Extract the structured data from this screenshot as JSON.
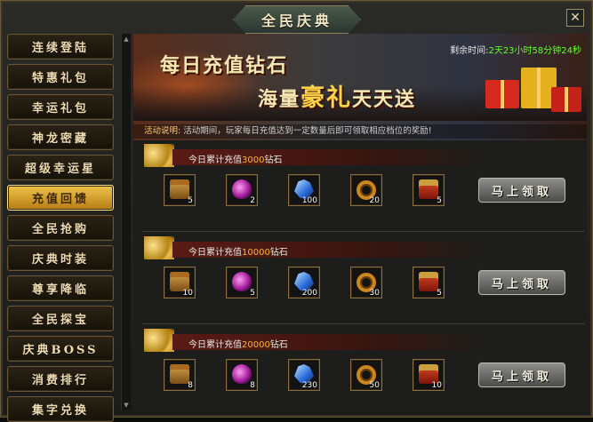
{
  "window": {
    "title": "全民庆典",
    "close_glyph": "✕"
  },
  "sidebar": {
    "items": [
      {
        "label": "连续登陆",
        "active": false
      },
      {
        "label": "特惠礼包",
        "active": false
      },
      {
        "label": "幸运礼包",
        "active": false
      },
      {
        "label": "神龙密藏",
        "active": false
      },
      {
        "label": "超级幸运星",
        "active": false
      },
      {
        "label": "充值回馈",
        "active": true
      },
      {
        "label": "全民抢购",
        "active": false
      },
      {
        "label": "庆典时装",
        "active": false
      },
      {
        "label": "尊享降临",
        "active": false
      },
      {
        "label": "全民探宝",
        "active": false
      },
      {
        "label": "庆典BOSS",
        "active": false
      },
      {
        "label": "消费排行",
        "active": false
      },
      {
        "label": "集字兑换",
        "active": false
      }
    ]
  },
  "banner": {
    "line1": "每日充值钻石",
    "line2_pre": "海量",
    "line2_hl": "豪礼",
    "line2_post": "天天送",
    "timer_label": "剩余时间:",
    "timer_value": "2天23小时58分钟24秒",
    "notice_label": "活动说明:",
    "notice_text": "活动期间，玩家每日充值达到一定数量后即可领取相应档位的奖励!"
  },
  "tiers": [
    {
      "req_prefix": "今日累计充值",
      "amount": "3000",
      "req_suffix": "钻石",
      "items": [
        {
          "icon": "gold-chest-icon",
          "qty": "5"
        },
        {
          "icon": "purple-gem-icon",
          "qty": "2"
        },
        {
          "icon": "blue-crystal-icon",
          "qty": "100"
        },
        {
          "icon": "gold-ring-icon",
          "qty": "20"
        },
        {
          "icon": "red-chest-icon",
          "qty": "5"
        }
      ],
      "claim_label": "马上领取"
    },
    {
      "req_prefix": "今日累计充值",
      "amount": "10000",
      "req_suffix": "钻石",
      "items": [
        {
          "icon": "gold-chest-icon",
          "qty": "10"
        },
        {
          "icon": "purple-gem-icon",
          "qty": "5"
        },
        {
          "icon": "blue-crystal-icon",
          "qty": "200"
        },
        {
          "icon": "gold-ring-icon",
          "qty": "30"
        },
        {
          "icon": "red-chest-icon",
          "qty": "5"
        }
      ],
      "claim_label": "马上领取"
    },
    {
      "req_prefix": "今日累计充值",
      "amount": "20000",
      "req_suffix": "钻石",
      "items": [
        {
          "icon": "gold-chest-icon",
          "qty": "8"
        },
        {
          "icon": "purple-gem-icon",
          "qty": "8"
        },
        {
          "icon": "blue-crystal-icon",
          "qty": "230"
        },
        {
          "icon": "gold-ring-icon",
          "qty": "50"
        },
        {
          "icon": "red-chest-icon",
          "qty": "10"
        }
      ],
      "claim_label": "马上领取"
    }
  ],
  "colors": {
    "accent_gold": "#efc34a",
    "timer_green": "#66ff33",
    "amount_orange": "#ffb23b"
  }
}
